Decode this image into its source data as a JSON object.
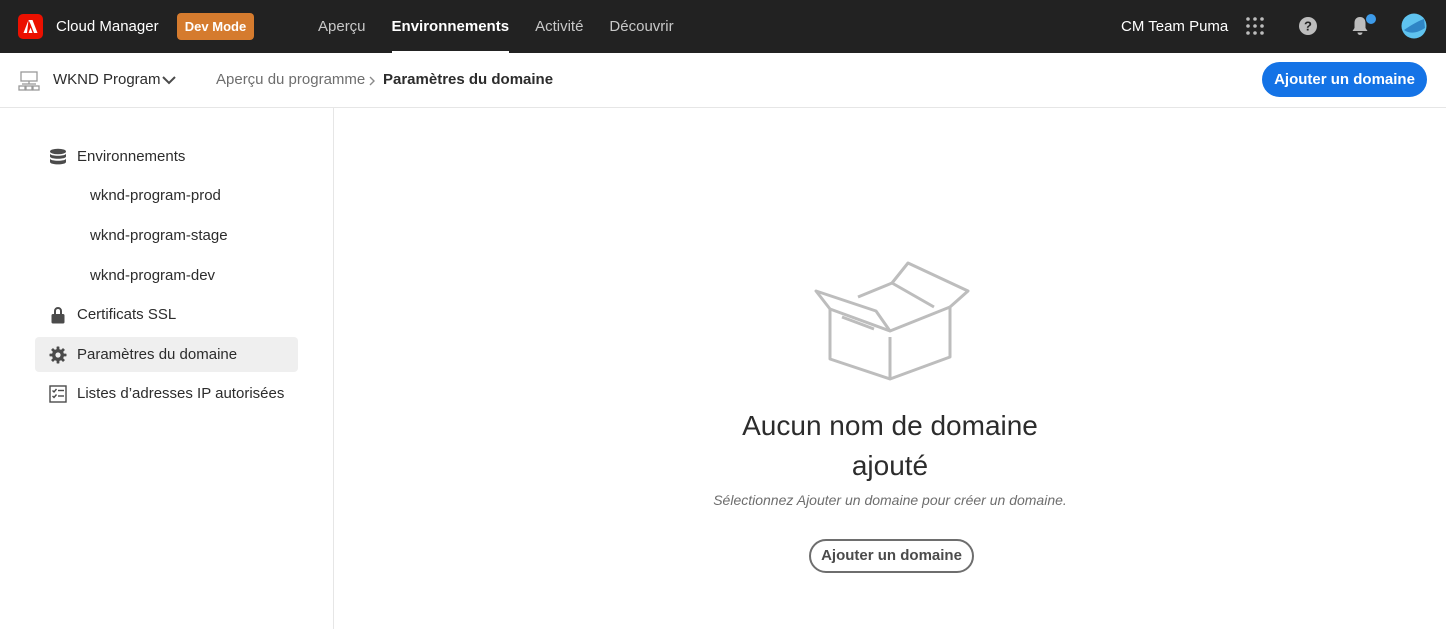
{
  "topbar": {
    "app_name": "Cloud Manager",
    "dev_mode": "Dev Mode",
    "nav": [
      "Aperçu",
      "Environnements",
      "Activité",
      "Découvrir"
    ],
    "active_nav": "Environnements",
    "org_name": "CM Team Puma",
    "brand_color": "#eb1000",
    "dev_mode_color": "#d57b2e"
  },
  "subheader": {
    "program_name": "WKND Program",
    "breadcrumb": [
      "Aperçu du programme",
      "Paramètres du domaine"
    ],
    "primary_action": "Ajouter un domaine",
    "accent_color": "#1473e6"
  },
  "sidebar": {
    "sections": [
      {
        "label": "Environnements",
        "icon": "database-icon"
      },
      {
        "label": "Certificats SSL",
        "icon": "lock-icon"
      },
      {
        "label": "Paramètres du domaine",
        "icon": "gear-icon",
        "selected": true
      },
      {
        "label": "Listes d’adresses IP autorisées",
        "icon": "checklist-icon"
      }
    ],
    "environments": [
      "wknd-program-prod",
      "wknd-program-stage",
      "wknd-program-dev"
    ]
  },
  "empty_state": {
    "icon": "empty-box-icon",
    "title_line1": "Aucun nom de domaine",
    "title_line2": "ajouté",
    "description": "Sélectionnez Ajouter un domaine pour créer un domaine.",
    "button": "Ajouter un domaine"
  }
}
